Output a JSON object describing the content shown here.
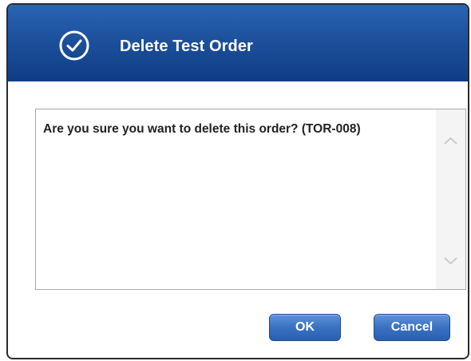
{
  "dialog": {
    "title": "Delete Test Order",
    "title_icon": "check-circle-icon",
    "message": "Are you sure you want to delete this order? (TOR-008)",
    "buttons": {
      "ok_label": "OK",
      "cancel_label": "Cancel"
    }
  },
  "colors": {
    "title_bar": "#1a4d98",
    "button": "#3a72c2",
    "dialog_border": "#2b2b2b"
  }
}
